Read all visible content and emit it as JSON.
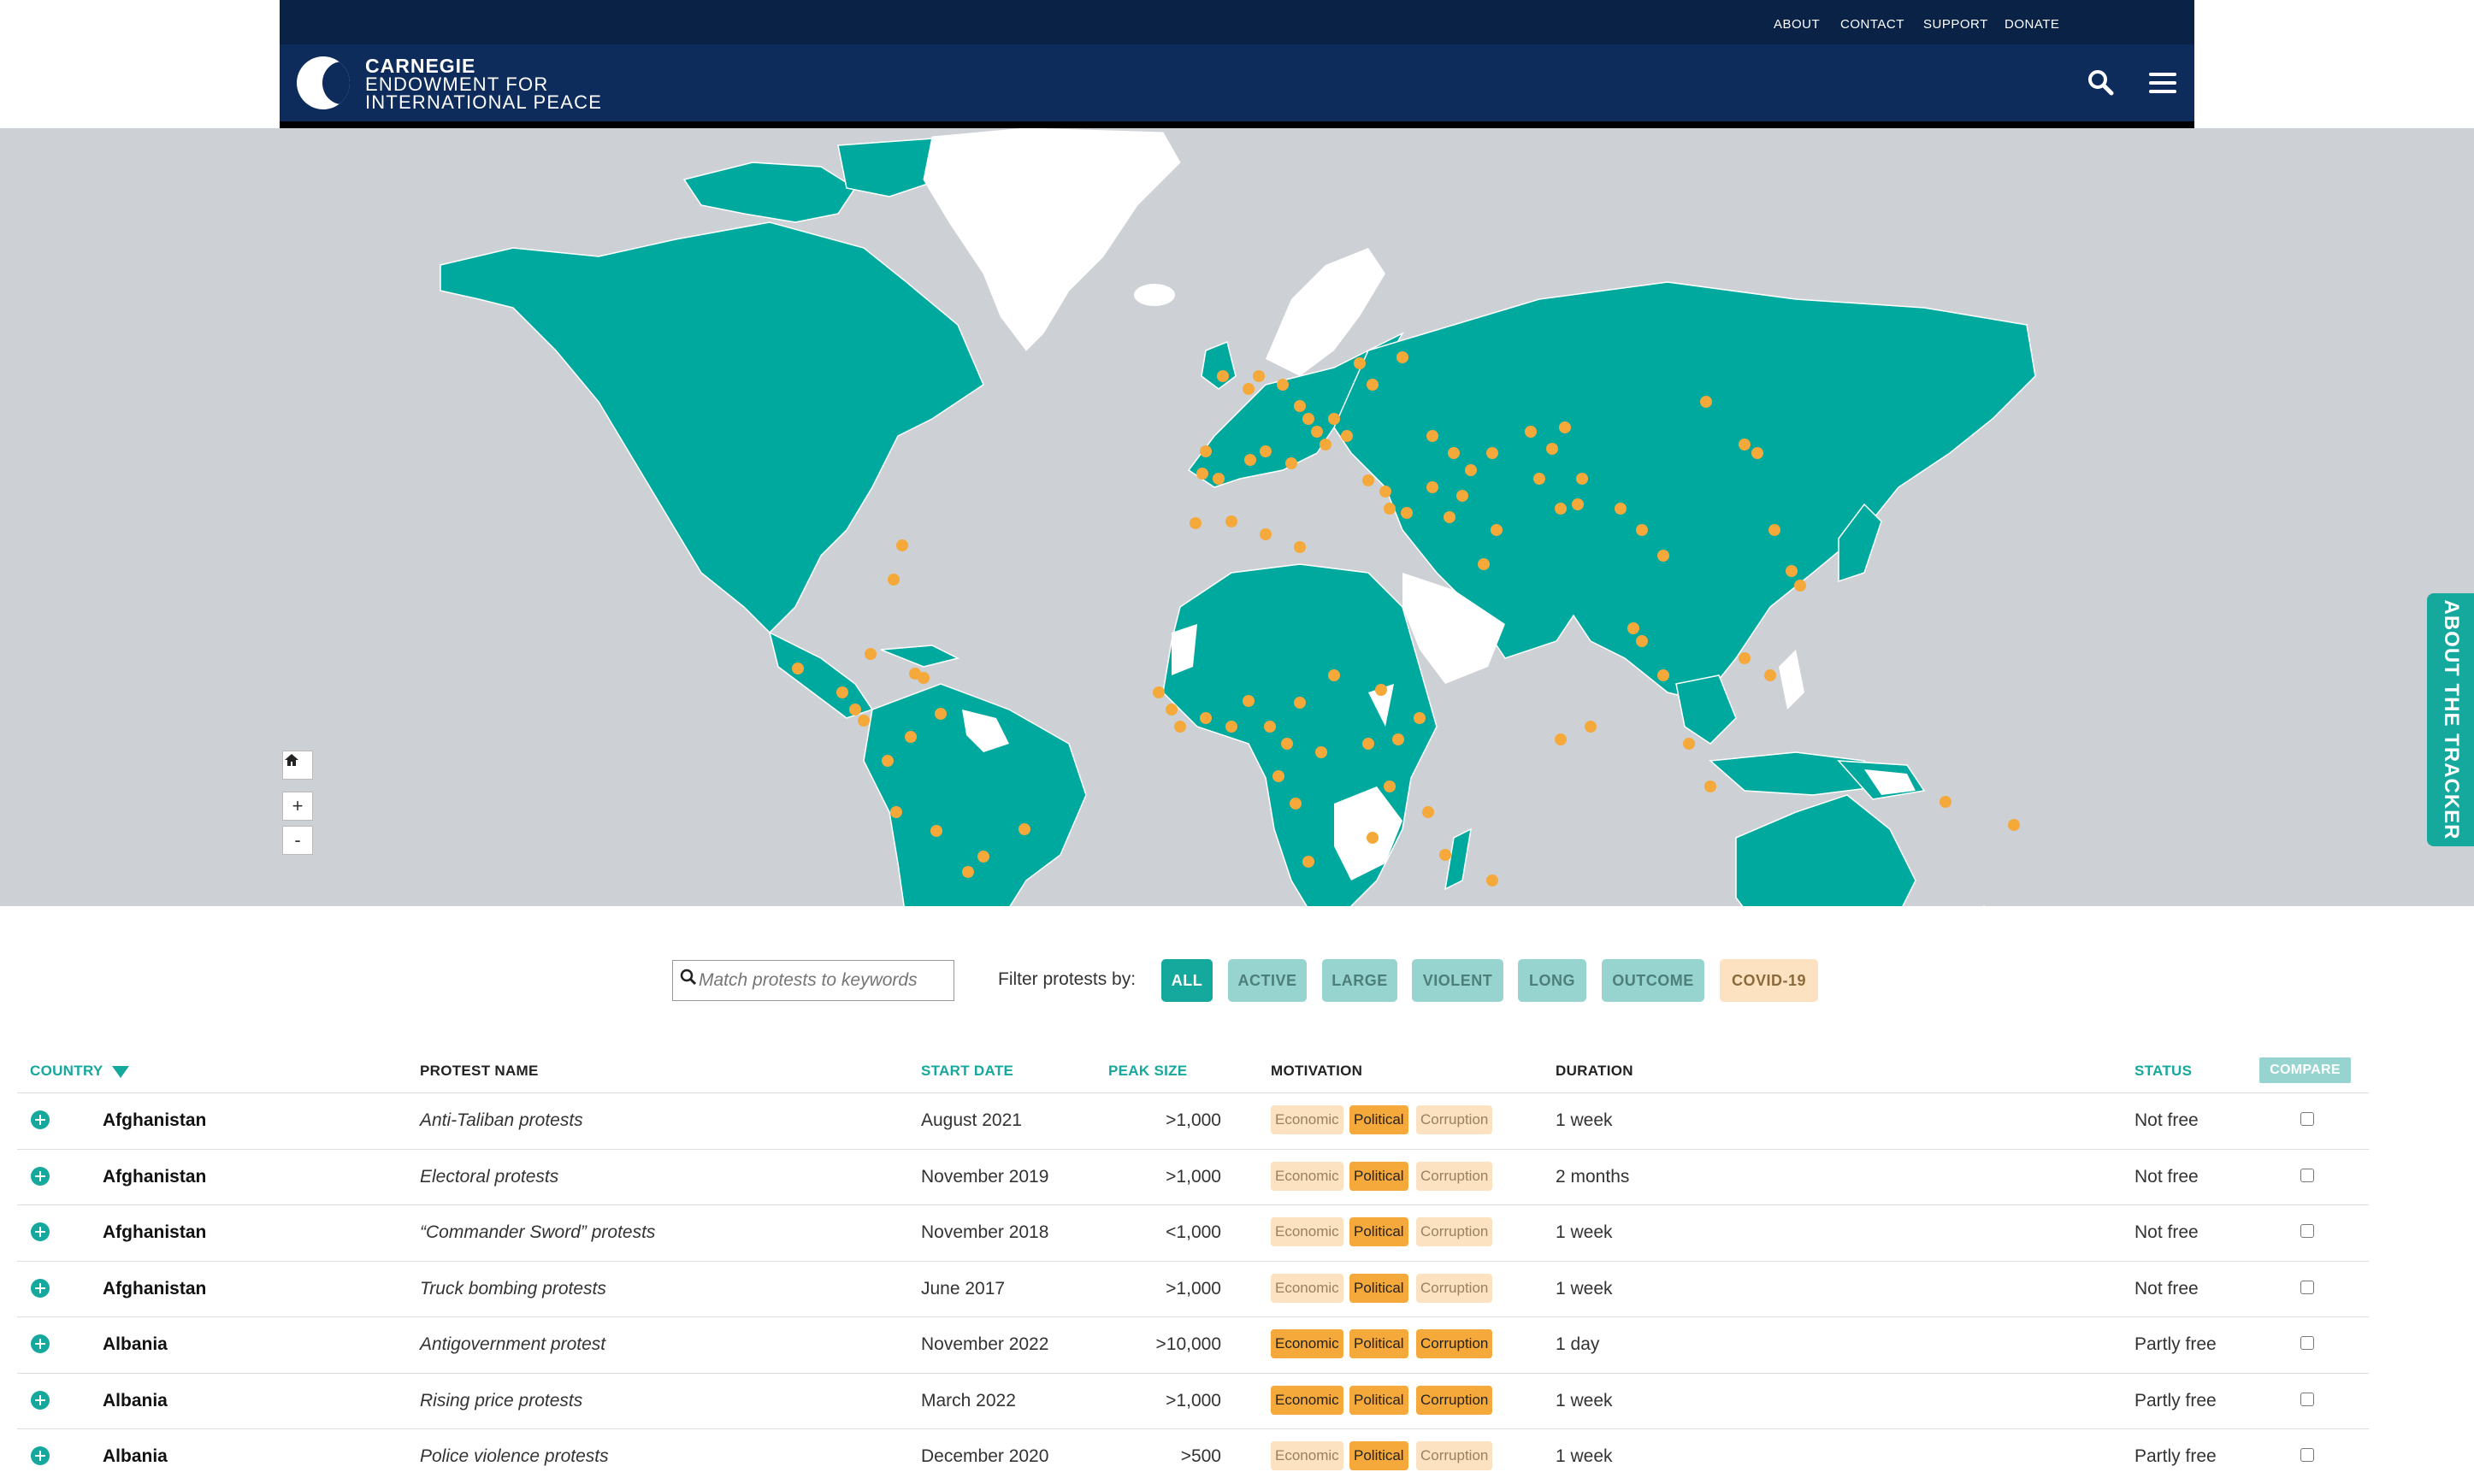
{
  "colors": {
    "navy": "#0e2c5b",
    "teal": "#15a89c",
    "tealLight": "#97d4d0",
    "orange": "#f5a93a",
    "orangeLight": "#fce2c0",
    "mapBg": "#cdd1d6",
    "land": "#00a99d"
  },
  "header": {
    "util_links": [
      "ABOUT",
      "CONTACT",
      "SUPPORT",
      "DONATE"
    ],
    "logo": {
      "line1": "CARNEGIE",
      "line2": "ENDOWMENT FOR",
      "line3": "INTERNATIONAL PEACE"
    },
    "search_icon": "search-icon",
    "menu_icon": "hamburger-menu-icon"
  },
  "map": {
    "controls": {
      "home": "⌂",
      "zoom_in": "+",
      "zoom_out": "-"
    }
  },
  "about_tab": "ABOUT THE TRACKER",
  "filters": {
    "search_placeholder": "Match protests to keywords",
    "label": "Filter protests by:",
    "buttons": [
      "ALL",
      "ACTIVE",
      "LARGE",
      "VIOLENT",
      "LONG",
      "OUTCOME",
      "COVID-19"
    ]
  },
  "table": {
    "headers": {
      "country": "COUNTRY",
      "protest": "PROTEST NAME",
      "start": "START DATE",
      "peak": "PEAK SIZE",
      "motivation": "MOTIVATION",
      "duration": "DURATION",
      "status": "STATUS",
      "compare": "COMPARE"
    },
    "rows": [
      {
        "country": "Afghanistan",
        "name": "Anti-Taliban protests",
        "start": "August 2021",
        "peak": ">1,000",
        "motivation": {
          "economic": false,
          "political": true,
          "corruption": false
        },
        "duration": "1 week",
        "status": "Not free"
      },
      {
        "country": "Afghanistan",
        "name": "Electoral protests",
        "start": "November 2019",
        "peak": ">1,000",
        "motivation": {
          "economic": false,
          "political": true,
          "corruption": false
        },
        "duration": "2 months",
        "status": "Not free"
      },
      {
        "country": "Afghanistan",
        "name": "“Commander Sword” protests",
        "start": "November 2018",
        "peak": "<1,000",
        "motivation": {
          "economic": false,
          "political": true,
          "corruption": false
        },
        "duration": "1 week",
        "status": "Not free"
      },
      {
        "country": "Afghanistan",
        "name": "Truck bombing protests",
        "start": "June 2017",
        "peak": ">1,000",
        "motivation": {
          "economic": false,
          "political": true,
          "corruption": false
        },
        "duration": "1 week",
        "status": "Not free"
      },
      {
        "country": "Albania",
        "name": "Antigovernment protest",
        "start": "November 2022",
        "peak": ">10,000",
        "motivation": {
          "economic": true,
          "political": true,
          "corruption": true
        },
        "duration": "1 day",
        "status": "Partly free"
      },
      {
        "country": "Albania",
        "name": "Rising price protests",
        "start": "March 2022",
        "peak": ">1,000",
        "motivation": {
          "economic": true,
          "political": true,
          "corruption": true
        },
        "duration": "1 week",
        "status": "Partly free"
      },
      {
        "country": "Albania",
        "name": "Police violence protests",
        "start": "December 2020",
        "peak": ">500",
        "motivation": {
          "economic": false,
          "political": true,
          "corruption": false
        },
        "duration": "1 week",
        "status": "Partly free"
      }
    ],
    "tag_labels": {
      "economic": "Economic",
      "political": "Political",
      "corruption": "Corruption"
    }
  }
}
